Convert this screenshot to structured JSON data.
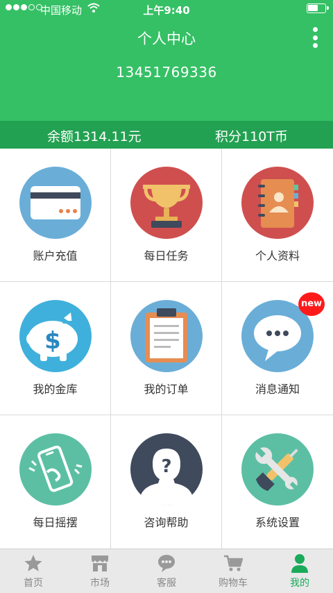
{
  "status_bar": {
    "carrier": "中国移动",
    "time": "上午9:40"
  },
  "header": {
    "title": "个人中心",
    "phone": "13451769336",
    "menu_icon": "more-vertical-icon"
  },
  "account": {
    "balance": "余额1314.11元",
    "points": "积分110T币"
  },
  "grid": [
    {
      "label": "账户充值",
      "icon": "credit-card-icon"
    },
    {
      "label": "每日任务",
      "icon": "trophy-icon"
    },
    {
      "label": "个人资料",
      "icon": "address-book-icon"
    },
    {
      "label": "我的金库",
      "icon": "piggy-bank-icon"
    },
    {
      "label": "我的订单",
      "icon": "clipboard-icon"
    },
    {
      "label": "消息通知",
      "icon": "chat-bubble-icon",
      "badge": "new"
    },
    {
      "label": "每日摇摆",
      "icon": "shake-phone-icon"
    },
    {
      "label": "咨询帮助",
      "icon": "question-person-icon"
    },
    {
      "label": "系统设置",
      "icon": "tools-icon"
    }
  ],
  "tabbar": [
    {
      "label": "首页",
      "icon": "star-icon"
    },
    {
      "label": "市场",
      "icon": "shop-icon"
    },
    {
      "label": "客服",
      "icon": "chat-icon"
    },
    {
      "label": "购物车",
      "icon": "cart-icon"
    },
    {
      "label": "我的",
      "icon": "user-icon",
      "active": true
    }
  ],
  "colors": {
    "header": "#35c065",
    "balance_bar": "#23a152",
    "active_tab": "#1aaa5a",
    "badge": "#ff1a1a"
  }
}
